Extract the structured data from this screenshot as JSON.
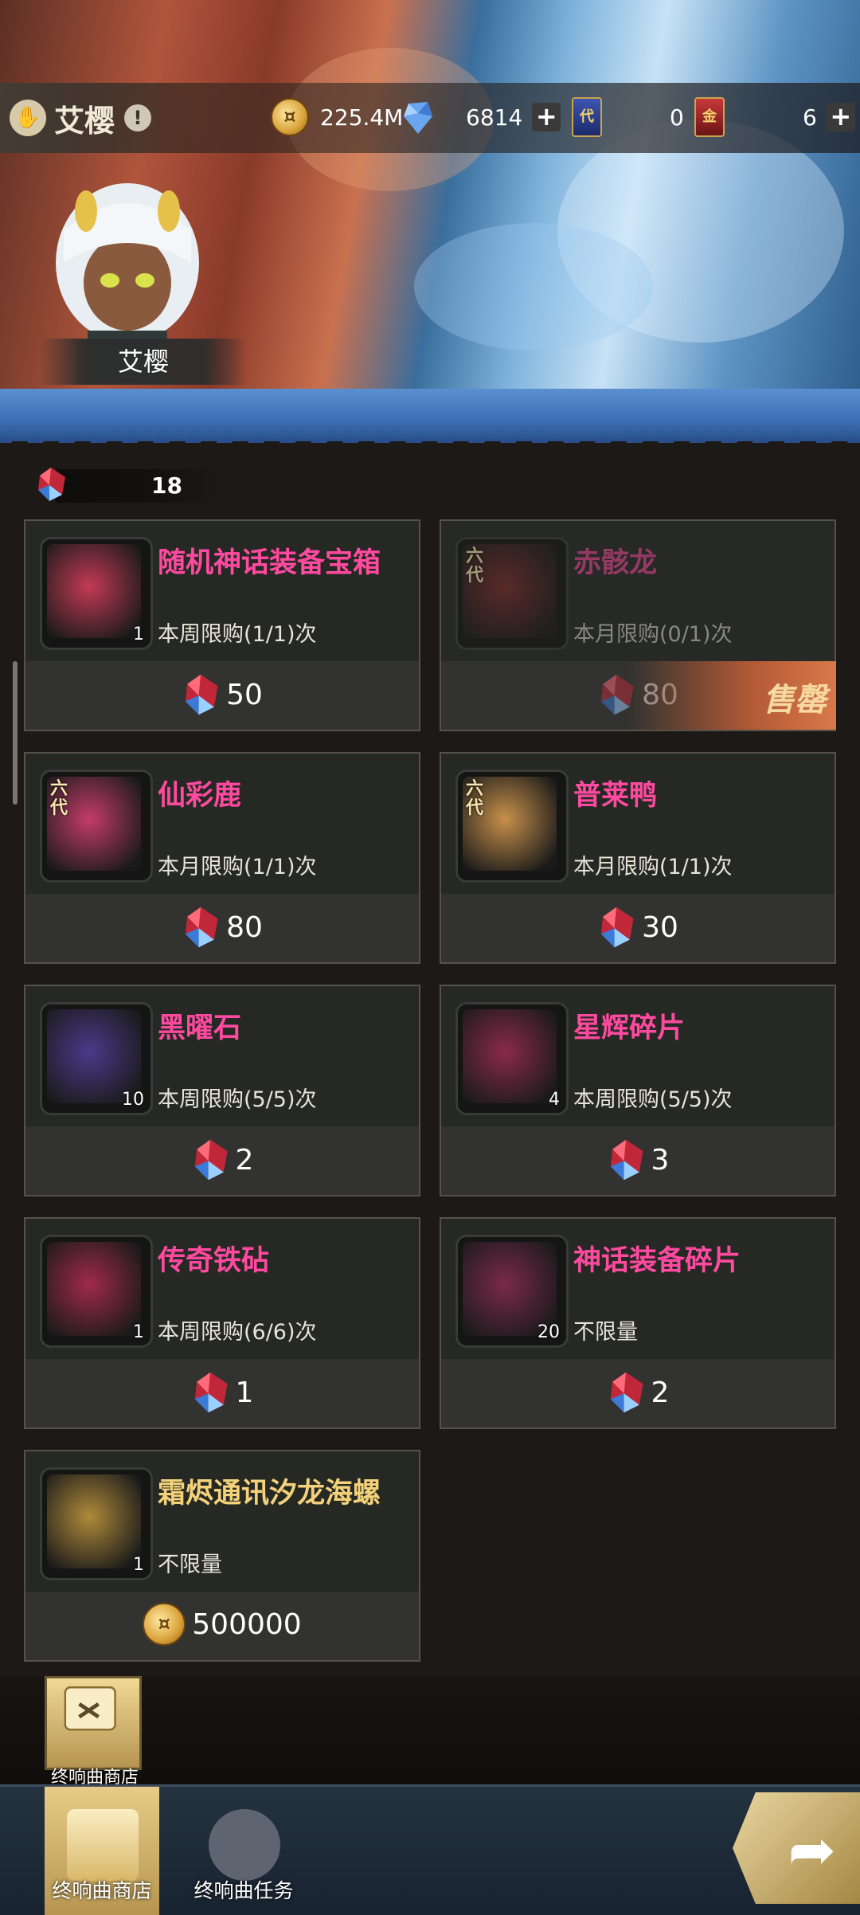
{
  "header": {
    "player_name": "艾樱",
    "warning_icon": "exclamation-icon",
    "resources": {
      "gold": "225.4M",
      "crystal": "6814",
      "ticket_blue": "0",
      "ticket_red": "6"
    },
    "ticket_blue_glyph": "代",
    "ticket_red_glyph": "金",
    "avatar_name": "艾樱"
  },
  "currency": {
    "gems": "18"
  },
  "shop": {
    "items": [
      {
        "title": "随机神话装备宝箱",
        "limit": "本周限购(1/1)次",
        "price": "50",
        "qty": "1",
        "color": "#c33a55",
        "currency": "gem"
      },
      {
        "title": "赤骸龙",
        "limit": "本月限购(0/1)次",
        "price": "80",
        "qty": "",
        "color": "#7a2b2b",
        "currency": "gem",
        "sold_out": "售罄",
        "badge": "六代"
      },
      {
        "title": "仙彩鹿",
        "limit": "本月限购(1/1)次",
        "price": "80",
        "qty": "",
        "color": "#c43c6a",
        "currency": "gem",
        "badge": "六代"
      },
      {
        "title": "普莱鸭",
        "limit": "本月限购(1/1)次",
        "price": "30",
        "qty": "",
        "color": "#c8914b",
        "currency": "gem",
        "badge": "六代"
      },
      {
        "title": "黑曜石",
        "limit": "本周限购(5/5)次",
        "price": "2",
        "qty": "10",
        "color": "#4a3a8a",
        "currency": "gem"
      },
      {
        "title": "星辉碎片",
        "limit": "本周限购(5/5)次",
        "price": "3",
        "qty": "4",
        "color": "#8a2a4a",
        "currency": "gem"
      },
      {
        "title": "传奇铁砧",
        "limit": "本周限购(6/6)次",
        "price": "1",
        "qty": "1",
        "color": "#a02a4a",
        "currency": "gem"
      },
      {
        "title": "神话装备碎片",
        "limit": "不限量",
        "price": "2",
        "qty": "20",
        "color": "#7a2a4a",
        "currency": "gem"
      },
      {
        "title": "霜烬通讯汐龙海螺",
        "limit": "不限量",
        "price": "500000",
        "qty": "1",
        "color": "#b08a3a",
        "currency": "gold"
      }
    ]
  },
  "side_tab": {
    "label": "终响曲商店"
  },
  "nav": {
    "items": [
      {
        "label": "终响曲商店"
      },
      {
        "label": "终响曲任务"
      }
    ]
  },
  "colors": {
    "title_pink": "#ff4aa0",
    "title_gold": "#f3d27a"
  }
}
